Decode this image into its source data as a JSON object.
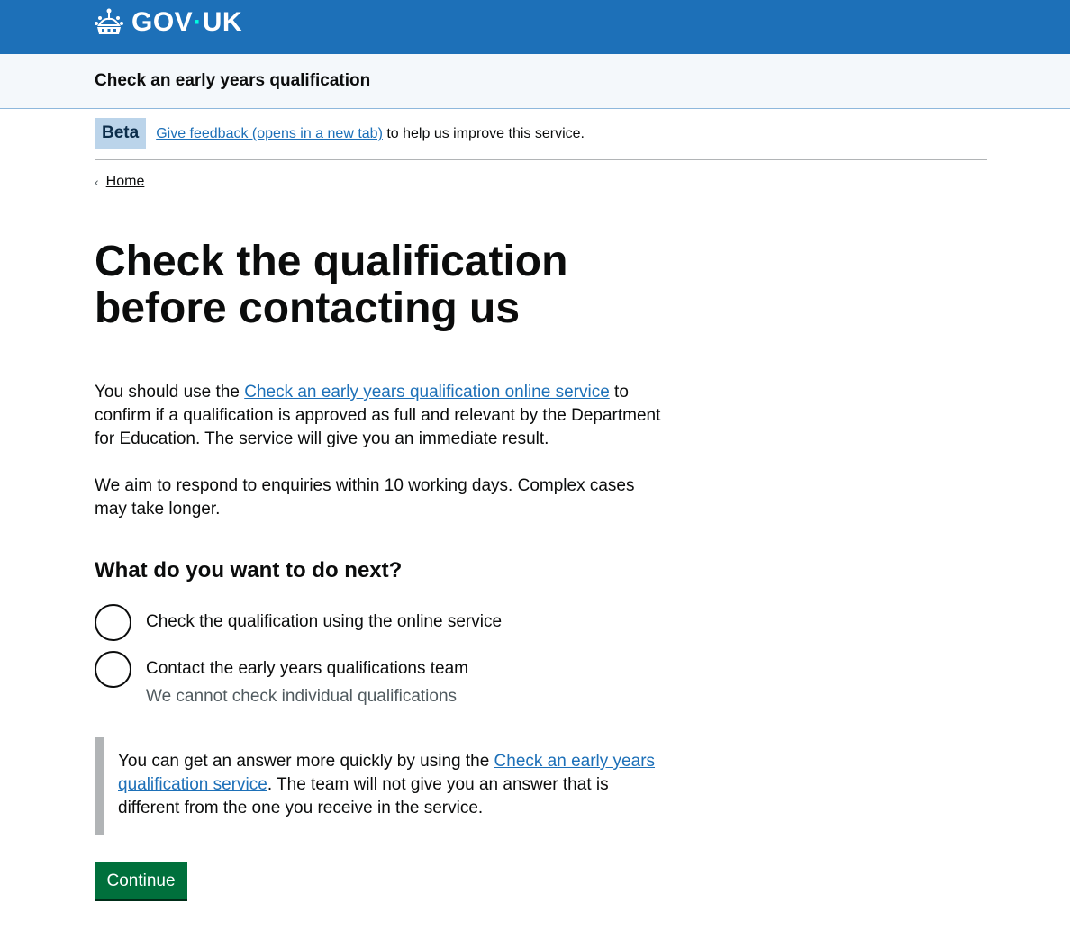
{
  "header": {
    "logo_text_left": "GOV",
    "logo_dot": "·",
    "logo_text_right": "UK"
  },
  "service": {
    "name": "Check an early years qualification"
  },
  "phase_banner": {
    "tag": "Beta",
    "link": "Give feedback (opens in a new tab)",
    "text": " to help us improve this service."
  },
  "breadcrumb": {
    "home": "Home"
  },
  "main": {
    "title_line1": "Check the qualification",
    "title_line2": "before contacting us",
    "para1_prefix": "You should use the ",
    "para1_link": "Check an early years qualification online service",
    "para1_suffix": " to confirm if a qualification is approved as full and relevant by the Department for Education. The service will give you an immediate result.",
    "para2": "We aim to respond to enquiries within 10 working days. Complex cases may take longer."
  },
  "question": {
    "heading": "What do you want to do next?",
    "options": [
      {
        "label": "Check the qualification using the online service"
      },
      {
        "label": "Contact the early years qualifications team",
        "hint": "We cannot check individual qualifications"
      }
    ]
  },
  "inset": {
    "prefix": "You can get an answer more quickly by using the ",
    "link": "Check an early years qualification service",
    "suffix": ". The team will not give you an answer that is different from the one you receive in the service."
  },
  "button": {
    "label": "Continue"
  },
  "colors": {
    "header_blue": "#1d70b8",
    "button_green": "#00703c",
    "link_blue": "#1d70b8"
  }
}
